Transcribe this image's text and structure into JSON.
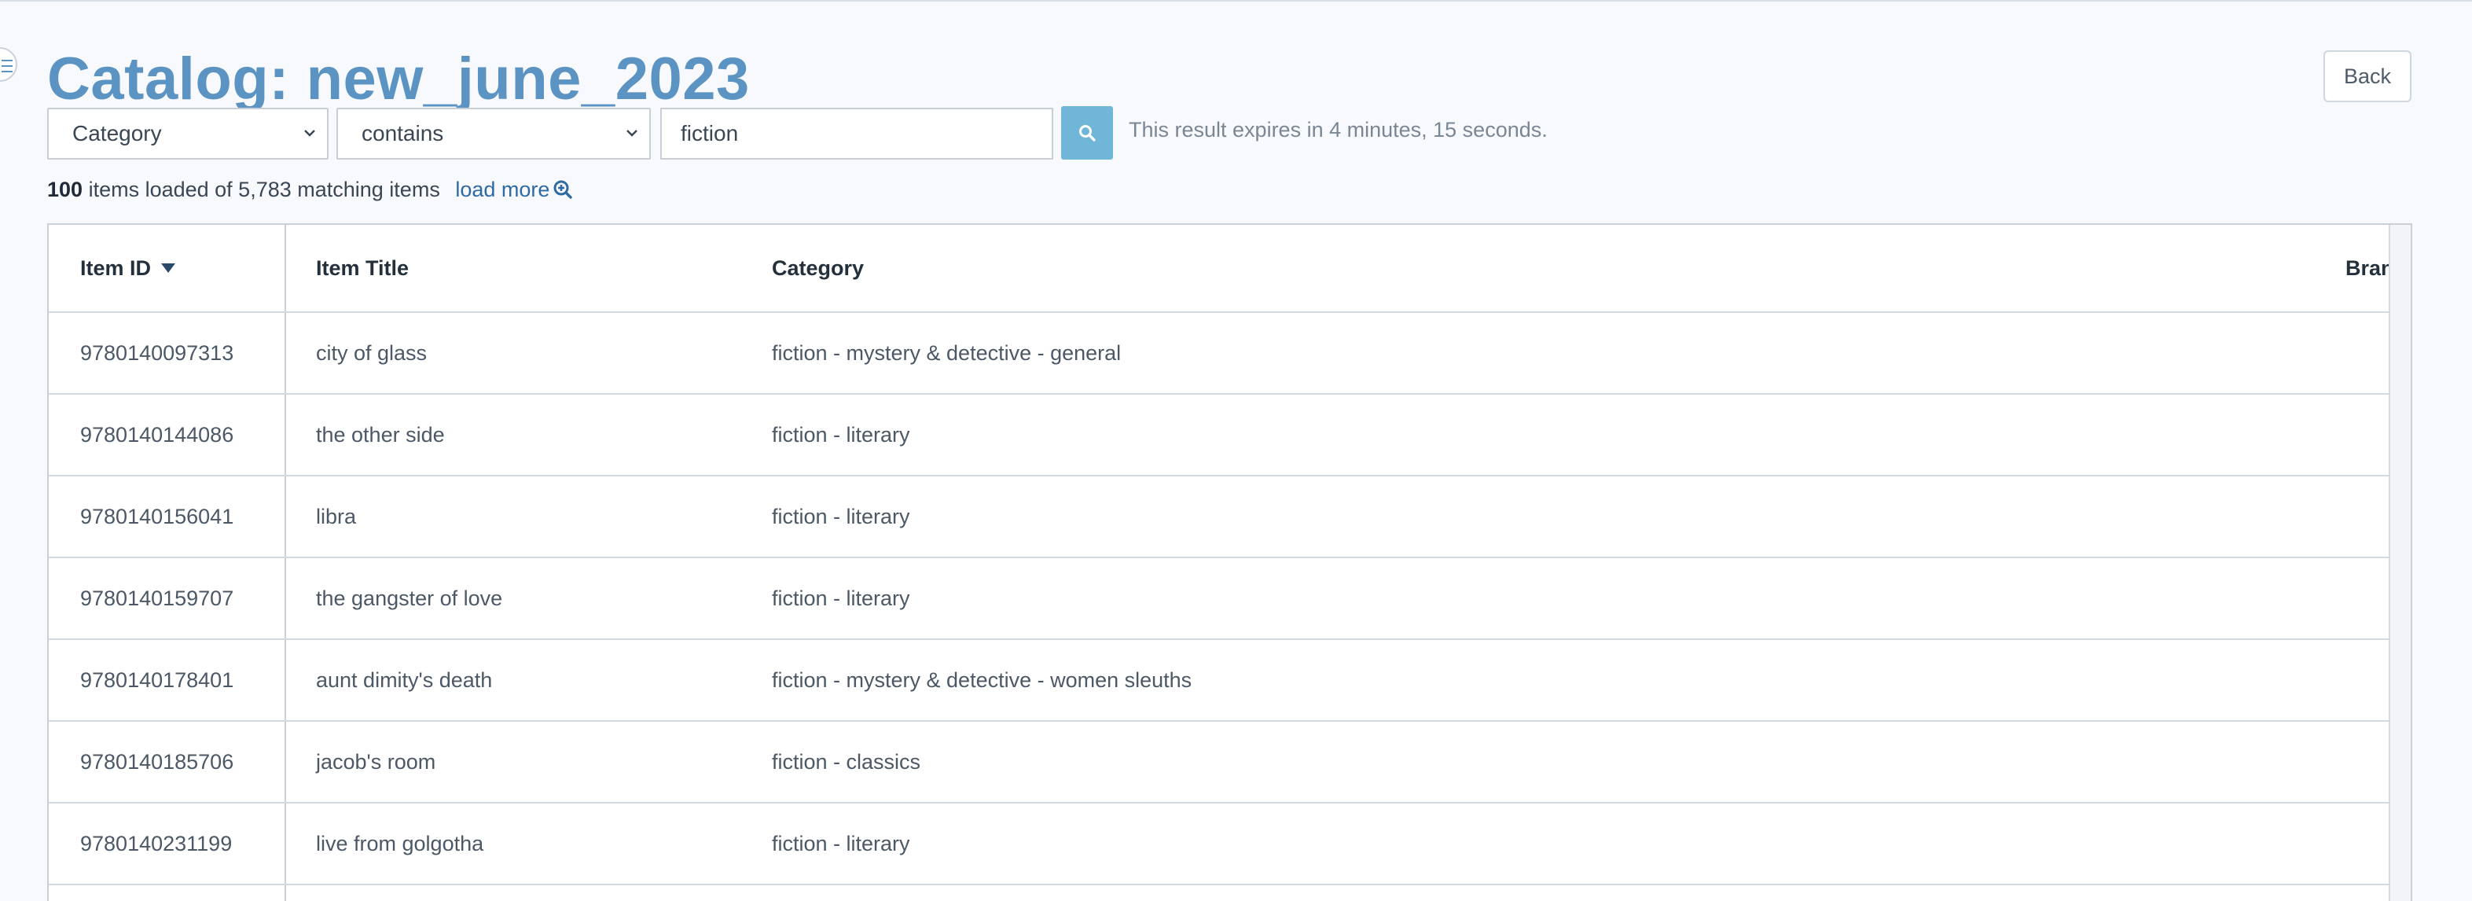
{
  "page": {
    "title": "Catalog: new_june_2023",
    "back_label": "Back"
  },
  "filter": {
    "field": "Category",
    "operator": "contains",
    "value": "fiction",
    "expires_text": "This result expires in 4 minutes, 15 seconds."
  },
  "summary": {
    "loaded": "100",
    "rest": "items loaded of 5,783 matching items",
    "load_more": "load more"
  },
  "table": {
    "headers": {
      "item_id": "Item ID",
      "item_title": "Item Title",
      "category": "Category",
      "brand": "Bran"
    },
    "rows": [
      {
        "id": "9780140097313",
        "title": "city of glass",
        "category": "fiction - mystery & detective - general"
      },
      {
        "id": "9780140144086",
        "title": "the other side",
        "category": "fiction - literary"
      },
      {
        "id": "9780140156041",
        "title": "libra",
        "category": "fiction - literary"
      },
      {
        "id": "9780140159707",
        "title": "the gangster of love",
        "category": "fiction - literary"
      },
      {
        "id": "9780140178401",
        "title": "aunt dimity's death",
        "category": "fiction - mystery & detective - women sleuths"
      },
      {
        "id": "9780140185706",
        "title": "jacob's room",
        "category": "fiction - classics"
      },
      {
        "id": "9780140231199",
        "title": "live from golgotha",
        "category": "fiction - literary"
      }
    ]
  },
  "colors": {
    "title": "#5b93c2",
    "search_button": "#6fb6d8",
    "link": "#2f6aa3"
  },
  "icons": {
    "menu": "menu-icon",
    "search": "search-icon",
    "load_more": "zoom-in-icon",
    "sort": "sort-descending-icon",
    "dropdown": "chevron-down-icon"
  }
}
